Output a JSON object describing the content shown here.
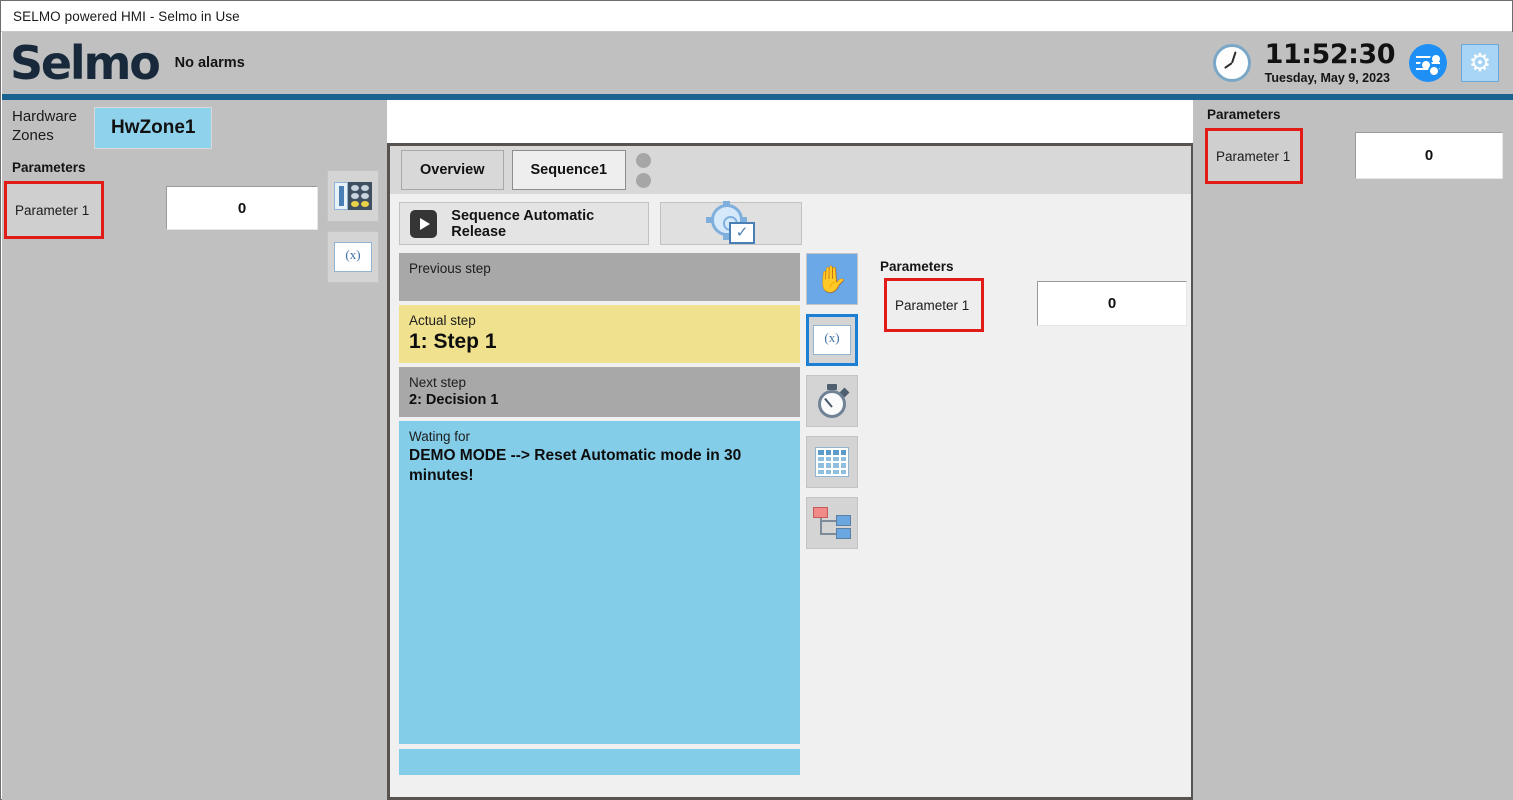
{
  "window": {
    "title": "SELMO powered HMI - Selmo in Use"
  },
  "header": {
    "logo": "Selmo",
    "alarm_status": "No alarms",
    "time": "11:52:30",
    "date": "Tuesday, May 9, 2023",
    "accent_color": "#1a6391",
    "clock_icon": "clock-icon",
    "sliders_icon": "sliders-icon",
    "gear_icon": "gear-icon"
  },
  "left_panel": {
    "zones_label": "Hardware Zones",
    "zone_tab": "HwZone1",
    "zone_tab_color": "#8ed2ec",
    "parameters_title": "Parameters",
    "parameter": {
      "name": "Parameter 1",
      "value": "0",
      "highlight_color": "#e01b18"
    },
    "icons": [
      {
        "name": "io-module-icon",
        "selected": false
      },
      {
        "name": "variables-icon",
        "selected": false
      }
    ]
  },
  "content": {
    "tabs": [
      {
        "label": "Overview",
        "selected": false
      },
      {
        "label": "Sequence1",
        "selected": true
      }
    ],
    "status_dots": 2,
    "toolbar": {
      "release_label": "Sequence Automatic Release",
      "play_icon": "play-icon",
      "config_icon": "gear-check-icon"
    },
    "steps": [
      {
        "label": "Previous step",
        "value": "",
        "state": "prev",
        "color": "#a8a8a8"
      },
      {
        "label": "Actual step",
        "value": "1: Step 1",
        "state": "actual",
        "color": "#efe18d"
      },
      {
        "label": "Next step",
        "value": "2: Decision 1",
        "state": "next",
        "color": "#a8a8a8"
      },
      {
        "label": "Wating for",
        "value": "DEMO MODE --> Reset Automatic mode in 30 minutes!",
        "state": "waiting",
        "color": "#84cde8"
      }
    ],
    "side_icons": [
      {
        "name": "hand-manual-icon",
        "selected": false,
        "active": true
      },
      {
        "name": "variables-icon",
        "selected": true,
        "active": false
      },
      {
        "name": "stopwatch-timer-icon",
        "selected": false,
        "active": false
      },
      {
        "name": "grid-matrix-icon",
        "selected": false,
        "active": false
      },
      {
        "name": "tree-hierarchy-icon",
        "selected": false,
        "active": false
      }
    ],
    "parameters_title": "Parameters",
    "parameter": {
      "name": "Parameter 1",
      "value": "0",
      "highlight_color": "#e01b18"
    }
  },
  "right_panel": {
    "parameters_title": "Parameters",
    "parameter": {
      "name": "Parameter 1",
      "value": "0",
      "highlight_color": "#e01b18"
    }
  }
}
